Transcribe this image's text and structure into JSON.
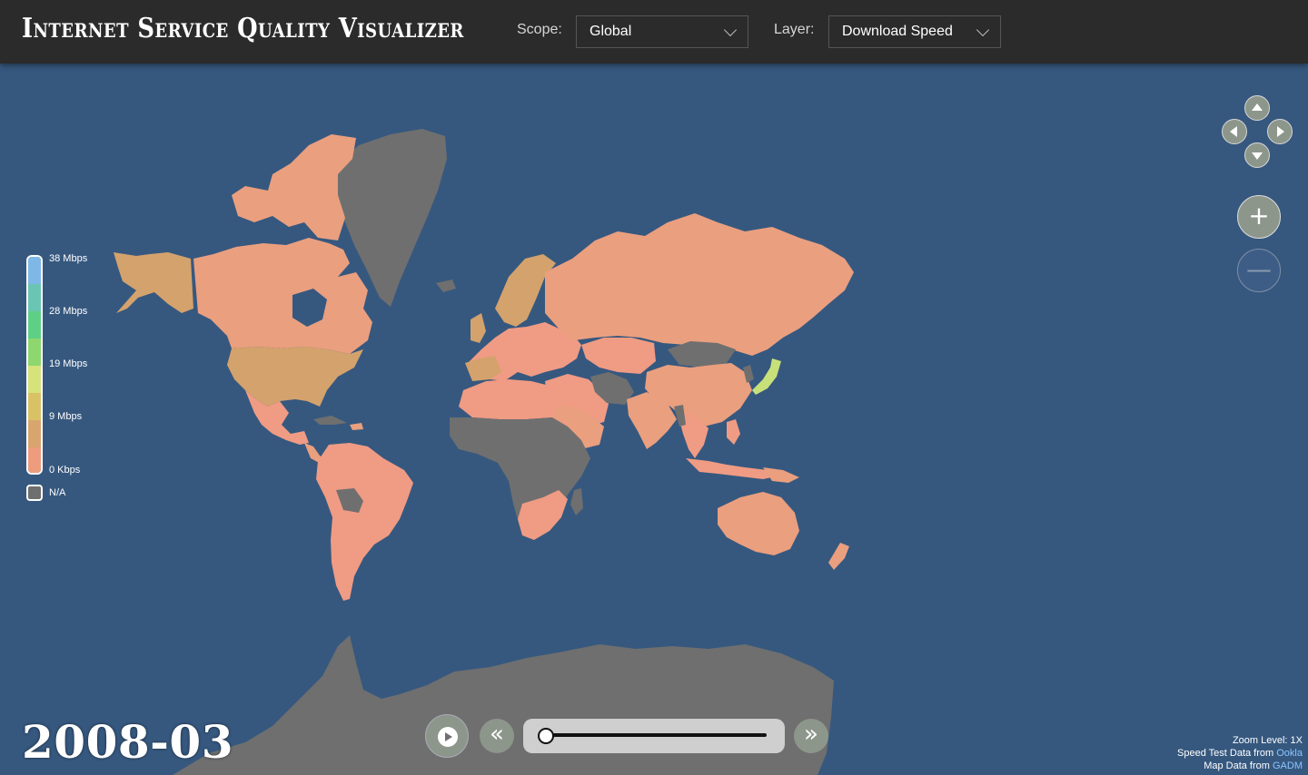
{
  "header": {
    "title": "Internet Service Quality Visualizer",
    "scope_label": "Scope:",
    "scope_value": "Global",
    "layer_label": "Layer:",
    "layer_value": "Download Speed"
  },
  "legend": {
    "labels": [
      "38 Mbps",
      "28 Mbps",
      "19 Mbps",
      "9 Mbps",
      "0 Kbps"
    ],
    "na_label": "N/A",
    "colors": [
      "#7fb8e6",
      "#6bc5b4",
      "#5fcf86",
      "#8ed66e",
      "#d6e27a",
      "#d9c266",
      "#d9a56e",
      "#ed9c7e"
    ]
  },
  "map_colors": {
    "ocean": "#36587f",
    "no_data": "#6f6f6f",
    "low": "#ea9f7f",
    "low_alt": "#f09b84",
    "mid": "#d4a26c",
    "high": "#c8e07a"
  },
  "timeline": {
    "date": "2008-03",
    "play_icon": "play-icon",
    "prev_icon": "«",
    "next_icon": "»",
    "position": 0
  },
  "info": {
    "zoom": "Zoom Level: 1X",
    "speed_prefix": "Speed Test Data from ",
    "speed_source": "Ookla",
    "map_prefix": "Map Data from ",
    "map_source": "GADM"
  },
  "nav": {
    "zoom_in": "+",
    "zoom_out": "—"
  }
}
